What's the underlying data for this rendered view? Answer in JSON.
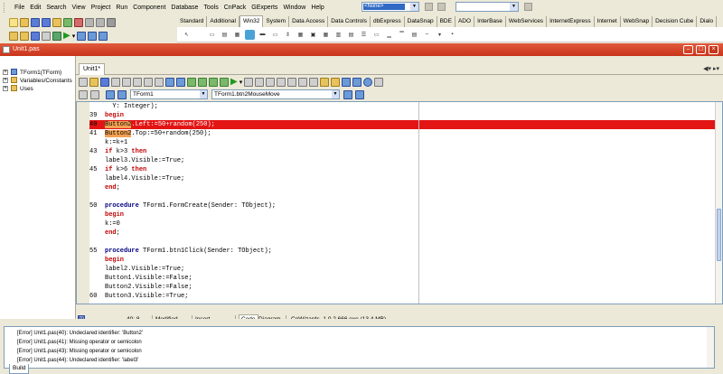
{
  "menu": [
    "File",
    "Edit",
    "Search",
    "View",
    "Project",
    "Run",
    "Component",
    "Database",
    "Tools",
    "CnPack",
    "GExperts",
    "Window",
    "Help"
  ],
  "desktop_combo": "<None>",
  "palette_tabs": [
    "Standard",
    "Additional",
    "Win32",
    "System",
    "Data Access",
    "Data Controls",
    "dbExpress",
    "DataSnap",
    "BDE",
    "ADO",
    "InterBase",
    "WebServices",
    "InternetExpress",
    "Internet",
    "WebSnap",
    "Decision Cube",
    "Dialo"
  ],
  "active_palette_tab": "Win32",
  "unit_window_title": "Unit1.pas",
  "tree": [
    {
      "label": "TForm1(TForm)",
      "expander": "+"
    },
    {
      "label": "Variables/Constants",
      "expander": "+"
    },
    {
      "label": "Uses",
      "expander": "+"
    }
  ],
  "editor_tab": "Unit1*",
  "class_combo": "TForm1",
  "method_combo": "TForm1.btn2MouseMove",
  "code": [
    {
      "n": "",
      "t": "  Y: Integer);"
    },
    {
      "n": "39",
      "t": "begin",
      "kw": "begin"
    },
    {
      "n": "40",
      "t": "Button2.Left:=50+random(250);",
      "err": true
    },
    {
      "n": "41",
      "t": "Button2.Top:=50+random(250);",
      "hlword": "Button2"
    },
    {
      "n": "",
      "t": "k:=k+1"
    },
    {
      "n": "43",
      "t": "if k>3 then",
      "kw": "if"
    },
    {
      "n": "",
      "t": "label3.Visible:=True;"
    },
    {
      "n": "45",
      "t": "if k>6 then",
      "kw": "if"
    },
    {
      "n": "",
      "t": "label4.Visible:=True;"
    },
    {
      "n": "",
      "t": "end;",
      "kw": "end"
    },
    {
      "n": "",
      "t": ""
    },
    {
      "n": "50",
      "t": "procedure TForm1.FormCreate(Sender: TObject);",
      "kw": "procedure"
    },
    {
      "n": "",
      "t": "begin",
      "kw": "begin"
    },
    {
      "n": "",
      "t": "k:=0"
    },
    {
      "n": "",
      "t": "end;",
      "kw": "end"
    },
    {
      "n": "",
      "t": ""
    },
    {
      "n": "55",
      "t": "procedure TForm1.btn1Click(Sender: TObject);",
      "kw": "procedure"
    },
    {
      "n": "",
      "t": "begin",
      "kw": "begin"
    },
    {
      "n": "",
      "t": "label2.Visible:=True;"
    },
    {
      "n": "",
      "t": "Button1.Visible:=False;"
    },
    {
      "n": "",
      "t": "Button2.Visible:=False;"
    },
    {
      "n": "60",
      "t": "Button3.Visible:=True;"
    },
    {
      "n": "",
      "t": ""
    }
  ],
  "status": {
    "position": "40: 8",
    "state": "Modified",
    "mode": "Insert",
    "tab_code": "Code",
    "tab_diagram": "Diagram",
    "wizard": "CnWizards_1.0.2.666.exe (13.4 MB)"
  },
  "messages": [
    "[Error] Unit1.pas(40): Undeclared identifier: 'Button2'",
    "[Error] Unit1.pas(41): Missing operator or semicolon",
    "[Error] Unit1.pas(43): Missing operator or semicolon",
    "[Error] Unit1.pas(44): Undeclared identifier: 'label3'"
  ],
  "build_tab": "Build",
  "colors": {
    "error_line": "#e31414",
    "title_bar": "#d94428",
    "highlight": "#f3a052",
    "keyword": "#000080"
  }
}
